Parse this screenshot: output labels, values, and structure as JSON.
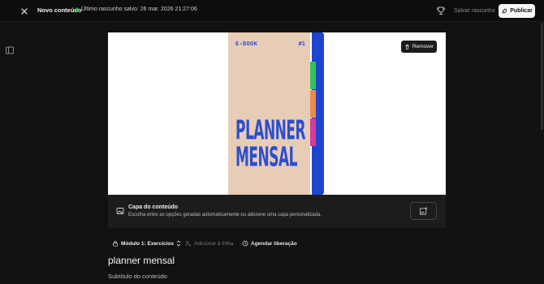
{
  "header": {
    "close_icon": "close-icon",
    "title": "Novo conteúdo",
    "save_status": "Último rascunho salvo: 26 mar. 2026 21:27:06",
    "status_color": "#22c55e",
    "draft_label": "Salvar rascunho",
    "publish_label": "Publicar",
    "badge_icon": "award-icon",
    "publish_icon": "rocket-icon"
  },
  "sidebar": {
    "toggle_icon": "sidebar-toggle-icon"
  },
  "cover": {
    "remove_label": "Remover",
    "remove_icon": "trash-icon",
    "book": {
      "label": "E-BOOK",
      "number": "#1",
      "title_line1": "PLANNER",
      "title_line2": "MENSAL",
      "colors": {
        "cover": "#e8cdb6",
        "spine": "#1e45cf",
        "tab1": "#35c15a",
        "tab2": "#f08a4b",
        "tab3": "#d7389c"
      }
    },
    "info_title": "Capa do conteúdo",
    "info_desc": "Escolha entre as opções geradas automaticamente ou adicione uma capa personalizada."
  },
  "meta": {
    "module": "Módulo 1: Exercícios",
    "track": "Adicionar à trilha",
    "schedule": "Agendar liberação"
  },
  "content": {
    "title": "planner mensal",
    "subtitle_placeholder": "Subtítulo do conteúdo"
  }
}
